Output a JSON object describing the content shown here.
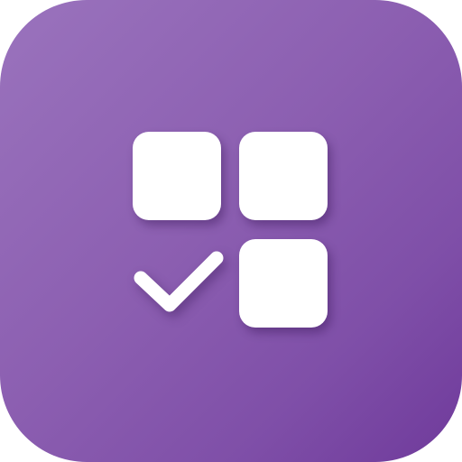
{
  "icon": {
    "name": "checklist-grid-icon",
    "colors": {
      "background_start": "#9a73bd",
      "background_end": "#6f3a9b",
      "glyph": "#ffffff"
    },
    "elements": [
      "square-tile",
      "square-tile",
      "square-tile",
      "check-mark"
    ]
  }
}
